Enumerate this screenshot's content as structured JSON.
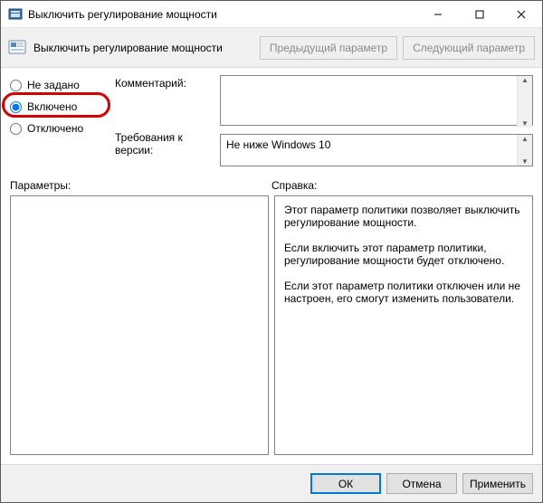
{
  "window": {
    "title": "Выключить регулирование мощности"
  },
  "header": {
    "title": "Выключить регулирование мощности",
    "prev_btn": "Предыдущий параметр",
    "next_btn": "Следующий параметр"
  },
  "radios": {
    "not_configured": "Не задано",
    "enabled": "Включено",
    "disabled": "Отключено",
    "selected": "enabled"
  },
  "fields": {
    "comment_label": "Комментарий:",
    "comment_value": "",
    "requirements_label": "Требования к версии:",
    "requirements_value": "Не ниже Windows 10"
  },
  "panes": {
    "options_label": "Параметры:",
    "help_label": "Справка:",
    "help_paragraphs": [
      "Этот параметр политики позволяет выключить регулирование мощности.",
      "Если включить этот параметр политики, регулирование мощности будет отключено.",
      "Если этот параметр политики отключен или не настроен, его смогут изменить пользователи."
    ]
  },
  "footer": {
    "ok": "ОК",
    "cancel": "Отмена",
    "apply": "Применить"
  }
}
